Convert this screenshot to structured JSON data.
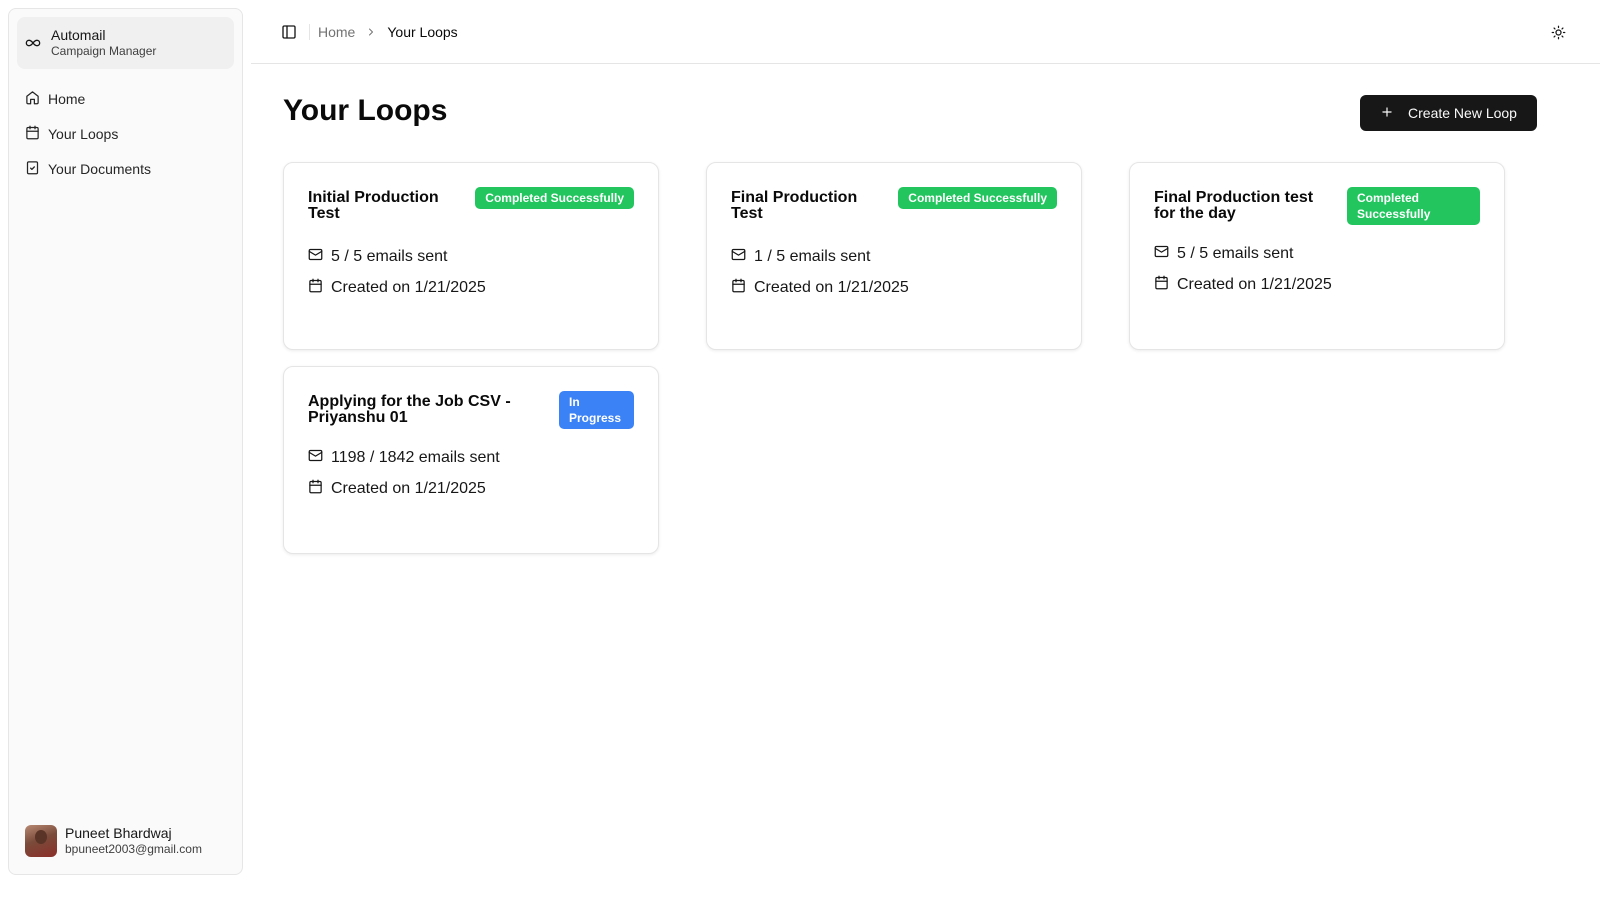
{
  "sidebar": {
    "brand_name": "Automail",
    "brand_sub": "Campaign Manager",
    "brand_icon": "infinity-icon",
    "items": [
      {
        "label": "Home",
        "icon": "home-icon"
      },
      {
        "label": "Your Loops",
        "icon": "calendar-icon"
      },
      {
        "label": "Your Documents",
        "icon": "clipboard-check-icon"
      }
    ],
    "user": {
      "name": "Puneet Bhardwaj",
      "email": "bpuneet2003@gmail.com"
    }
  },
  "header": {
    "breadcrumb_home": "Home",
    "breadcrumb_current": "Your Loops",
    "toggle_icon": "panel-left-icon",
    "theme_icon": "sun-icon"
  },
  "main": {
    "title": "Your Loops",
    "create_label": "Create New Loop",
    "loops": [
      {
        "title": "Initial Production Test",
        "status": "Completed Successfully",
        "emails": "5 / 5 emails sent",
        "created": "Created on 1/21/2025"
      },
      {
        "title": "Final Production Test",
        "status": "Completed Successfully",
        "emails": "1 / 5 emails sent",
        "created": "Created on 1/21/2025"
      },
      {
        "title": "Final Production test for the day",
        "status": "Completed Successfully",
        "emails": "5 / 5 emails sent",
        "created": "Created on 1/21/2025"
      },
      {
        "title": "Applying for the Job CSV - Priyanshu 01",
        "status": "In Progress",
        "emails": "1198 / 1842 emails sent",
        "created": "Created on 1/21/2025"
      }
    ]
  },
  "colors": {
    "completed": "#22c55e",
    "in_progress": "#3b82f6",
    "primary_button": "#171717"
  }
}
